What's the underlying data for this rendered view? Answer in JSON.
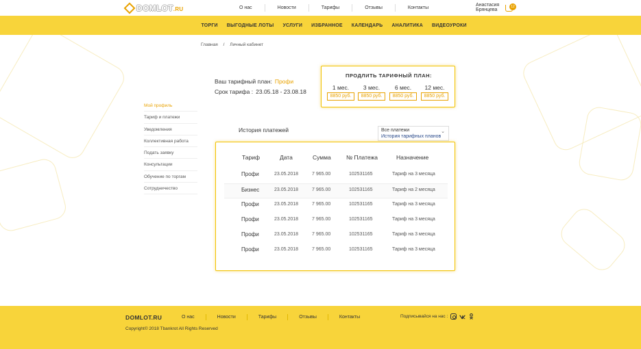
{
  "header": {
    "logo_main": "DOMLOT",
    "logo_suffix": ".RU",
    "nav": [
      "О нас",
      "Новости",
      "Тарифы",
      "Отзывы",
      "Контакты"
    ],
    "user_line1": "Анастасия",
    "user_line2": "Брянцева",
    "cart_count": "12"
  },
  "main_nav": [
    "Торги",
    "Выгодные лоты",
    "Услуги",
    "Избранное",
    "Календарь",
    "Аналитика",
    "Видеоуроки"
  ],
  "breadcrumb": {
    "home": "Главная",
    "sep": "/",
    "current": "Личный кабинет"
  },
  "sidebar": [
    "Мой профиль",
    "Тариф и платежи",
    "Уведомления",
    "Коллективная работа",
    "Подать заявку",
    "Консультации",
    "Обучение по торгам",
    "Сотрудничество"
  ],
  "plan": {
    "label": "Ваш тарифный план:",
    "name": "Профи",
    "term_label": "Срок тарифа :",
    "term": "23.05.18 - 23.08.18"
  },
  "extend": {
    "title": "Продлить тарифный план:",
    "options": [
      {
        "label": "1 мес.",
        "price": "8850 руб."
      },
      {
        "label": "3 мес.",
        "price": "8850 руб."
      },
      {
        "label": "6 мес.",
        "price": "8850 руб."
      },
      {
        "label": "12 мес.",
        "price": "8850 руб."
      }
    ]
  },
  "history": {
    "title": "История платежей",
    "filter_selected": "Все платежи",
    "filter_option": "История тарифных планов",
    "columns": [
      "Тариф",
      "Дата",
      "Сумма",
      "№ Платежа",
      "Назначение"
    ],
    "rows": [
      {
        "tariff": "Профи",
        "date": "23.05.2018",
        "sum": "7 965.00",
        "number": "102531165",
        "purpose": "Тариф на 3 месяца"
      },
      {
        "tariff": "Бизнес",
        "date": "23.05.2018",
        "sum": "7 965.00",
        "number": "102531165",
        "purpose": "Тариф на 2 месяца"
      },
      {
        "tariff": "Профи",
        "date": "23.05.2018",
        "sum": "7 965.00",
        "number": "102531165",
        "purpose": "Тариф на 3 месяца"
      },
      {
        "tariff": "Профи",
        "date": "23.05.2018",
        "sum": "7 965.00",
        "number": "102531165",
        "purpose": "Тариф на 3 месяца"
      },
      {
        "tariff": "Профи",
        "date": "23.05.2018",
        "sum": "7 965.00",
        "number": "102531165",
        "purpose": "Тариф на 3 месяца"
      },
      {
        "tariff": "Профи",
        "date": "23.05.2018",
        "sum": "7 965.00",
        "number": "102531165",
        "purpose": "Тариф на 3 месяца"
      }
    ]
  },
  "footer": {
    "logo": "DOMLOT.RU",
    "nav": [
      "О нас",
      "Новости",
      "Тарифы",
      "Отзывы",
      "Контакты"
    ],
    "subscribe": "Подписывайся на нас :",
    "copyright": "Copyright© 2018 Tbankrot All Rights Reserved"
  },
  "colors": {
    "accent": "#e9a200",
    "brand_yellow": "#f8d43a",
    "link_blue": "#2a4a8a"
  }
}
